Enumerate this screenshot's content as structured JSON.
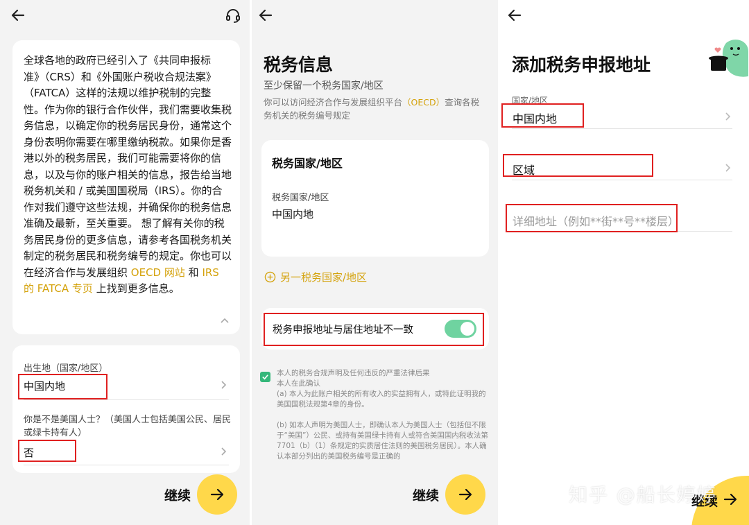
{
  "screen1": {
    "info_text_before_links": "全球各地的政府已经引入了《共同申报标准》（CRS）和《外国账户税收合规法案》（FATCA）这样的法规以维护税制的完整性。作为你的银行合作伙伴，我们需要收集税务信息，以确定你的税务居民身份，通常这个身份表明你需要在哪里缴纳税款。如果你是香港以外的税务居民，我们可能需要将你的信息，以及与你的账户相关的信息，报告给当地税务机关和 / 或美国国税局（IRS）。你的合作对我们遵守这些法规，并确保你的税务信息准确及最新，至关重要。 想了解有关你的税务居民身份的更多信息，请参考各国税务机关制定的税务居民和税务编号的规定。你也可以在经济合作与发展组织",
    "link_oecd": "OECD 网站",
    "and_text": "和",
    "link_irs": "IRS 的 FATCA 专页",
    "info_text_after_links": "上找到更多信息。",
    "birthplace_label": "出生地（国家/地区）",
    "birthplace_value": "中国内地",
    "us_person_label": "你是不是美国人士？（美国人士包括美国公民、居民或绿卡持有人）",
    "us_person_value": "否",
    "continue_label": "继续"
  },
  "screen2": {
    "title": "税务信息",
    "subtitle": "至少保留一个税务国家/地区",
    "note_before": "你可以访问经济合作与发展组织平台",
    "note_link": "（OECD）",
    "note_after": "查询各税务机关的税务编号规定",
    "card_title": "税务国家/地区",
    "field_label": "税务国家/地区",
    "field_value": "中国内地",
    "add_label": "另一税务国家/地区",
    "toggle_label": "税务申报地址与居住地址不一致",
    "toggle_on": true,
    "declaration": [
      "本人的税务合规声明及任何违反的严重法律后果",
      "本人在此确认",
      "(a) 本人为此账户相关的所有收入的实益拥有人，或特此证明我的美国国税法规第4章的身份。",
      "",
      "(b) 如本人声明为美国人士，即确认本人为美国人士（包括但不限于“美国”）公民、或持有美国绿卡持有人或符合美国国内税收法第7701（b）（1）条规定的实质居住法则的美国税务居民）。本人确认本部分列出的美国税务编号是正确的"
    ],
    "continue_label": "继续"
  },
  "screen3": {
    "title": "添加税务申报地址",
    "country_label": "国家/地区",
    "country_value": "中国内地",
    "region_value": "区域",
    "detail_placeholder": "详细地址（例如**街**号**楼层）",
    "continue_label": "继续"
  },
  "watermark": "知乎 @船长婷婷",
  "colors": {
    "accent_yellow": "#ffd84a",
    "link_gold": "#d4a20b",
    "toggle_green": "#6fd3a0",
    "highlight_red": "#e02020"
  }
}
